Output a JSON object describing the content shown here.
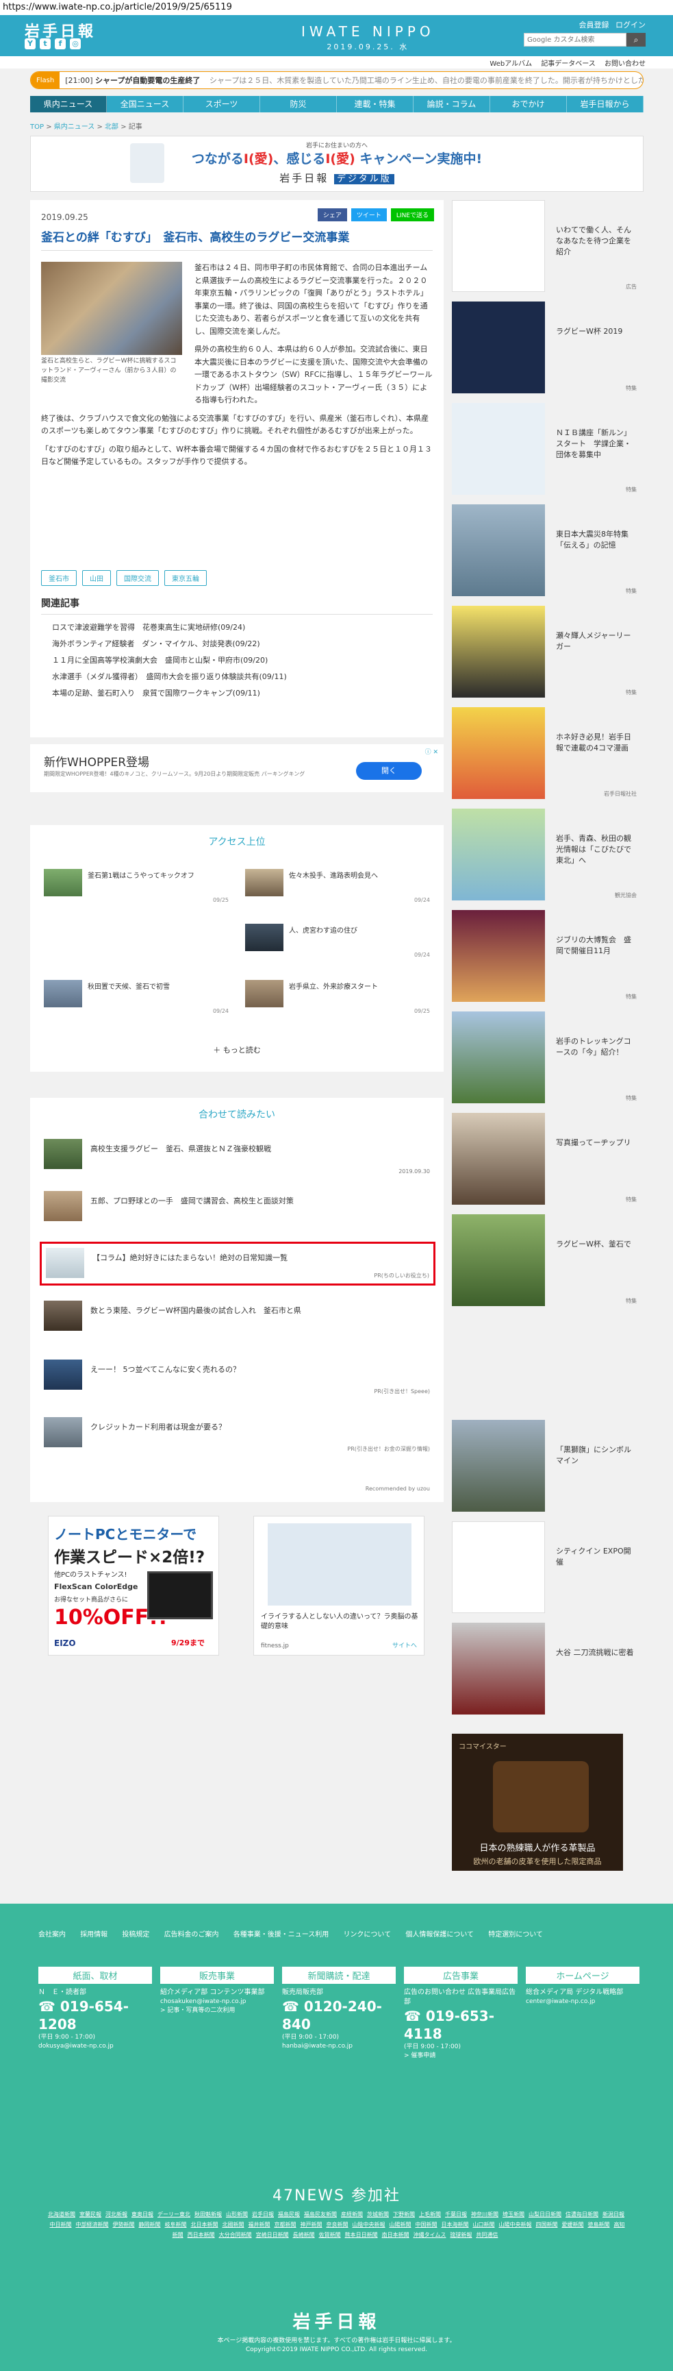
{
  "url": "https://www.iwate-np.co.jp/article/2019/9/25/65119",
  "header": {
    "logo": "岩手日報",
    "brand": "IWATE NIPPO",
    "date": "2019.09.25. 水",
    "member_label": "会員登録",
    "login_label": "ログイン",
    "search_placeholder": "Google カスタム検索",
    "social": [
      "Y",
      "t",
      "f",
      "◎"
    ]
  },
  "subbar": [
    "Webアルバム",
    "記事データベース",
    "お問い合わせ"
  ],
  "flash": {
    "tag": "Flash",
    "time": "[21:00]",
    "headline": "シャープが自動要電の生産終了",
    "rest": "シャープは２５日、木質素を製造していた乃間工場のライン生止め、自社の要電の事前産業を終了した。開示者が持ちかけとしたの"
  },
  "nav": [
    "県内ニュース",
    "全国ニュース",
    "スポーツ",
    "防災",
    "連載・特集",
    "論説・コラム",
    "おでかけ",
    "岩手日報から"
  ],
  "breadcrumb": [
    "TOP",
    "県内ニュース",
    "北部",
    "記事"
  ],
  "promo": {
    "small": "岩手にお住まいの方へ",
    "big_pre": "つながる",
    "big_ai1": "I(愛)",
    "big_mid": "、感じる",
    "big_ai2": "I(愛)",
    "big_post": " キャンペーン実施中!",
    "logo": "岩手日報",
    "digital": "デジタル版"
  },
  "article": {
    "date": "2019.09.25",
    "share_fb": "シェア",
    "share_tw": "ツイート",
    "share_ln": "LINEで送る",
    "title": "釜石との絆「むすび」　釜石市、高校生のラグビー交流事業",
    "caption": "釜石と高校生らと、ラグビーW杯に挑戦するスコットランド・アーヴィーさん（前から３人目）の撮影交流",
    "p1": "釜石市は２４日、同市甲子町の市民体育館で、合同の日本進出チームと県選抜チームの高校生によるラグビー交流事業を行った。２０２０年東京五輪・パラリンピックの「復興「ありがとう」ラストホテル」事業の一環。終了後は、同国の高校生らを招いて「むすび」作りを通じた交流もあり、若者らがスポーツと食を通じて互いの文化を共有し、国際交流を楽しんだ。",
    "p2": "県外の高校生約６０人、本県は約６０人が参加。交流試合後に、東日本大震災後に日本のラグビーに支援を頂いた、国際交流や大会準備の一環であるホストタウン（SW）RFCに指導し、１５年ラグビーワールドカップ（W杯）出場経験者のスコット・アーヴィー氏（３５）による指導も行われた。",
    "p3": "終了後は、クラブハウスで食文化の勉強による交流事業「むすびのすび」を行い、県産米（釜石市しぐれ）、本県産のスポーツも楽しめてタウン事業「むすびのむすび」作りに挑戦。それぞれ個性があるむすびが出来上がった。",
    "p4": "「むすびのむすび」の取り組みとして、W杯本番会場で開催する４カ国の食材で作るおむすびを２５日と１０月１３日など開催予定しているもの。スタッフが手作りで提供する。",
    "tags": [
      "釜石市",
      "山田",
      "国際交流",
      "東京五輪"
    ],
    "related_title": "関連記事",
    "related": [
      "ロスで津波避難学を習得　花巻東高生に実地研修(09/24)",
      "海外ボランティア経験者　ダン・マイケル、対談発表(09/22)",
      "１１月に全国高等学校演劇大会　盛岡市と山梨・甲府市(09/20)",
      "水津選手（メダル獲得者）　盛岡市大会を振り返り体験談共有(09/11)",
      "本場の足跡、釜石町入り　泉質で国際ワークキャンプ(09/11)"
    ]
  },
  "ad_whopper": {
    "title": "新作WHOPPER登場",
    "sub": "期間限定WHOPPER登場！4種のキノコと、クリームソース。9月20日より期間限定販売 パーキングキング",
    "button": "開く",
    "adx": "ⓘ ✕"
  },
  "access": {
    "title": "アクセス上位",
    "items": [
      {
        "text": "釜石第1戦はこうやってキックオフ",
        "date": "09/25"
      },
      {
        "text": "佐々木投手、進路表明会見へ",
        "date": "09/24"
      },
      {
        "text": "人、虎宮わす追の住び",
        "date": "09/24"
      },
      {
        "text": "秋田置で天候、釜石で初雪",
        "date": "09/24"
      },
      {
        "text": "岩手県立、外来診療スタート",
        "date": "09/25"
      }
    ],
    "more": "もっと読む"
  },
  "together": {
    "title": "合わせて読みたい",
    "rows": [
      {
        "text": "高校生支援ラグビー　釜石、県選抜とＮＺ強豪校観戦",
        "meta": "2019.09.30"
      },
      {
        "text": "五郎、プロ野球との一手　盛岡で講習会、高校生と面談対策",
        "meta": ""
      },
      {
        "text": "【コラム】絶対好きにはたまらない！絶対の日常知識一覧",
        "meta": "PR(ちのしいお役立ち)"
      },
      {
        "text": "数とう東陸、ラグビーW杯国内最後の試合し入れ　釜石市と県",
        "meta": ""
      },
      {
        "text": "え一ー！ 5つ並べてこんなに安く売れるの？",
        "meta": "PR(引き出せ！Speee)"
      },
      {
        "text": "クレジットカード利用者は現金が要る？",
        "meta": "PR(引き出せ！お金の深掘り情報)"
      }
    ],
    "rec": "Recommended by uzou"
  },
  "ad_pc": {
    "l1": "ノートPCとモニターで",
    "l2": "作業スピード×2倍!?",
    "l3": "他PCのラストチャンス!",
    "l4": "FlexScan ColorEdge",
    "l5": "お得なセット商品がさらに",
    "l6": "10%OFF!!",
    "l7": "EIZO",
    "l8": "9/29まで"
  },
  "ad_fit": {
    "text": "イライラする人としない人の違いって？ラ奥脳の基礎的意味",
    "src": "fitness.jp",
    "link": "サイトへ"
  },
  "side": [
    {
      "text": "いわてで働く人、そんなあなたを待つ企業を紹介",
      "tag": "広告"
    },
    {
      "text": "ラグビーW杯 2019",
      "tag": "特集"
    },
    {
      "text": "ＮＩＢ講座「新ルン」スタート　学課企業・団体を募集中",
      "tag": "特集"
    },
    {
      "text": "東日本大震災8年特集「伝える」の記憶",
      "tag": "特集"
    },
    {
      "text": "瀬々輝人メジャーリーガー",
      "tag": "特集"
    },
    {
      "text": "ホネ好き必見！岩手日報で連載の4コマ漫画",
      "tag": "岩手日報社社"
    },
    {
      "text": "岩手、青森、秋田の観光情報は「こびたびで東北」へ",
      "tag": "観光協会"
    },
    {
      "text": "ジブリの大博覧会　盛岡で開催日11月",
      "tag": "特集"
    },
    {
      "text": "岩手のトレッキングコースの「今」紹介！",
      "tag": "特集"
    },
    {
      "text": "写真撮ってーヂップリ",
      "tag": "特集"
    },
    {
      "text": "ラグビーW杯、釜石で",
      "tag": "特集"
    },
    {
      "text": "「黒獅旗」にシンボルマイン",
      "tag": ""
    },
    {
      "text": "シティクイン EXPO開催",
      "tag": ""
    },
    {
      "text": "大谷 二刀流挑戦に密着",
      "tag": ""
    }
  ],
  "ad_bag": {
    "head": "日本の熟練職人が作る革製品",
    "sub": "欧州の老舗の皮革を使用した限定商品",
    "brand": "ココマイスター"
  },
  "footer": {
    "links": [
      "会社案内",
      "採用情報",
      "投稿規定",
      "広告料金のご案内",
      "各種事業・後援・ニュース利用",
      "リンクについて",
      "個人情報保護について",
      "特定選別について"
    ],
    "cards": [
      {
        "title": "紙面、取材",
        "l1": "Ｎ　Ｅ・読者部",
        "tel": "019-654-1208",
        "l2": "(平日 9:00 - 17:00)",
        "l3": "dokusya@iwate-np.co.jp"
      },
      {
        "title": "販売事業",
        "l1": "紹介メディア部 コンテンツ事業部",
        "tel": "",
        "l2": "chosakuken@iwate-np.co.jp",
        "l3": "> 記事・写真等の二次利用"
      },
      {
        "title": "新聞購読・配達",
        "l1": "販売局販売部",
        "tel": "0120-240-840",
        "l2": "(平日 9:00 - 17:00)",
        "l3": "hanbai@iwate-np.co.jp"
      },
      {
        "title": "広告事業",
        "l1": "広告のお問い合わせ 広告事業局広告部",
        "tel": "019-653-4118",
        "l2": "(平日 9:00 - 17:00)",
        "l3": "> 催事申請"
      },
      {
        "title": "ホームページ",
        "l1": "総合メディア局 デジタル戦略部",
        "tel": "",
        "l2": "center@iwate-np.co.jp",
        "l3": ""
      }
    ],
    "title47": "47NEWS 参加社",
    "list47": [
      "北海道新聞",
      "室蘭民報",
      "河北新報",
      "東奥日報",
      "デーリー東北",
      "秋田魁新報",
      "山形新聞",
      "岩手日報",
      "福島民報",
      "福島民友新聞",
      "産経新聞",
      "茨城新聞",
      "下野新聞",
      "上毛新聞",
      "千葉日報",
      "神奈川新聞",
      "埼玉新聞",
      "山梨日日新聞",
      "信濃毎日新聞",
      "新潟日報",
      "中日新聞",
      "中部経済新聞",
      "伊勢新聞",
      "静岡新聞",
      "岐阜新聞",
      "北日本新聞",
      "北國新聞",
      "福井新聞",
      "京都新聞",
      "神戸新聞",
      "奈良新聞",
      "山陰中央新報",
      "山陽新聞",
      "中国新聞",
      "日本海新聞",
      "山口新聞",
      "山陽中央新報",
      "四国新聞",
      "愛媛新聞",
      "徳島新聞",
      "高知新聞",
      "西日本新聞",
      "大分合同新聞",
      "宮崎日日新聞",
      "長崎新聞",
      "佐賀新聞",
      "熊本日日新聞",
      "南日本新聞",
      "沖縄タイムス",
      "琉球新報",
      "共同通信"
    ],
    "logo": "岩手日報",
    "note": "本ページ掲載内容の複数使用を禁じます。すべての著作権は岩手日報社に帰属します。",
    "copy": "Copyright©2019 IWATE NIPPO CO.,LTD. All rights reserved."
  }
}
